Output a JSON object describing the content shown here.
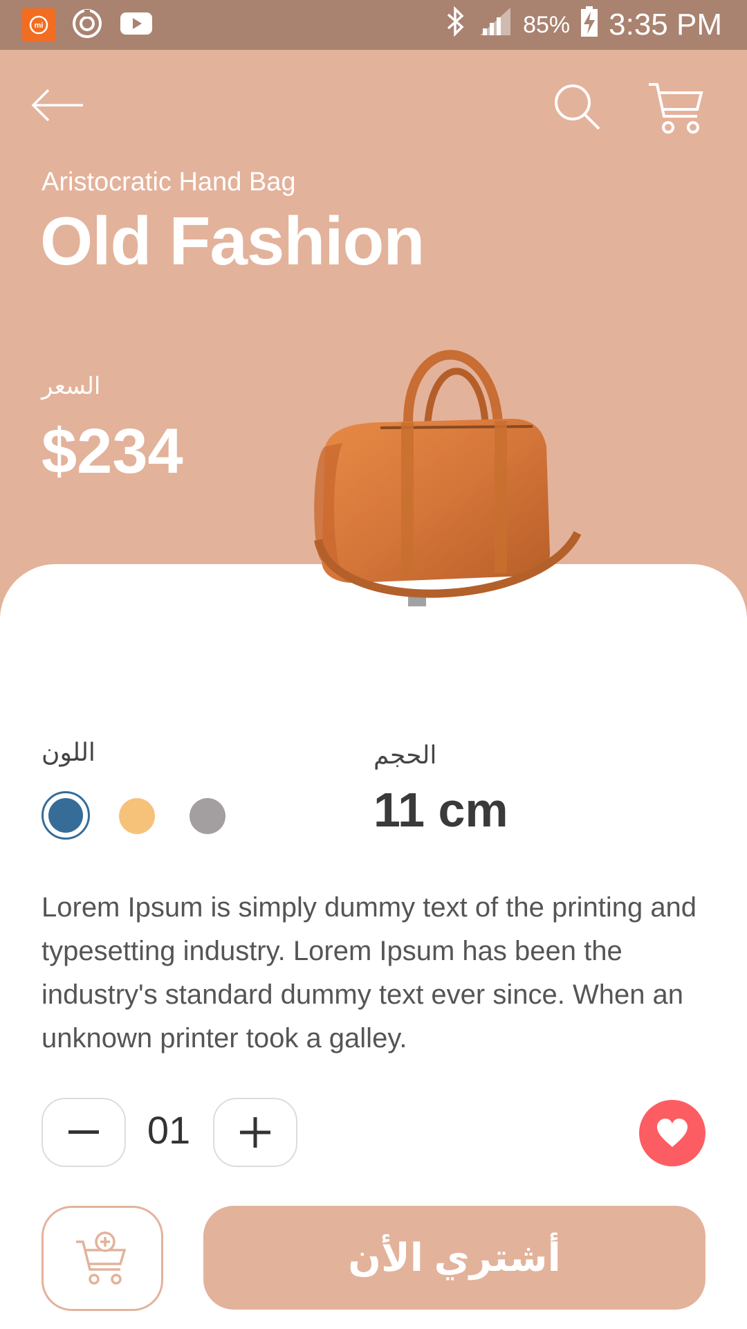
{
  "status_bar": {
    "battery": "85%",
    "time": "3:35 PM",
    "icons": [
      "mi-icon",
      "sync-icon",
      "youtube-icon",
      "bluetooth-icon",
      "signal-icon",
      "battery-charging-icon"
    ]
  },
  "header": {
    "subtitle": "Aristocratic Hand Bag",
    "title": "Old Fashion",
    "price_label": "السعر",
    "price": "$234",
    "background_color": "#e3b29b",
    "icons": [
      "back-arrow-icon",
      "search-icon",
      "cart-icon"
    ]
  },
  "product": {
    "color_label": "اللون",
    "colors": [
      "#356c98",
      "#f6c27a",
      "#a39e9f"
    ],
    "selected_color_index": 0,
    "size_label": "الحجم",
    "size_value": "11 cm",
    "description": "Lorem Ipsum is simply dummy text of the printing and typesetting industry. Lorem Ipsum has been the industry's standard dummy text ever since. When an unknown printer took a galley."
  },
  "quantity": {
    "value": "01"
  },
  "actions": {
    "buy_label": "أشتري الأن",
    "favorite_color": "#fc5d63",
    "accent_color": "#e3b29b"
  }
}
